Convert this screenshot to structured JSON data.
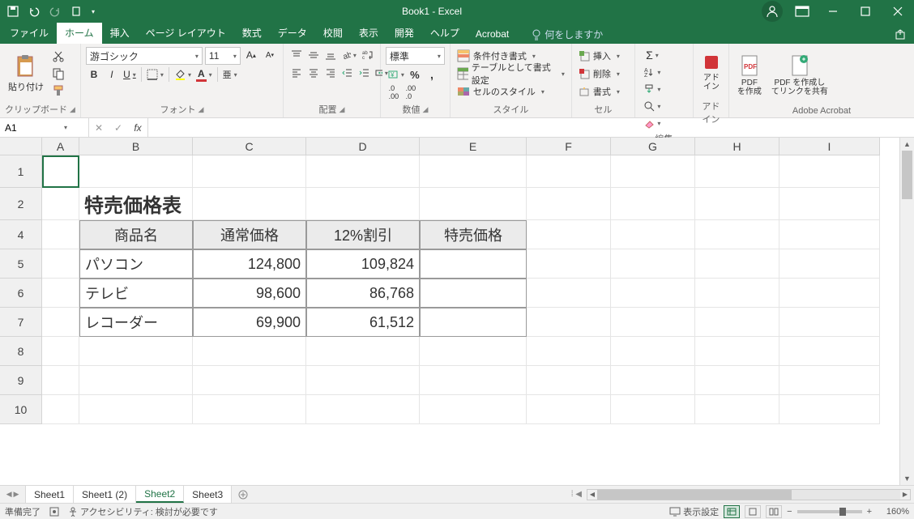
{
  "title": "Book1  -  Excel",
  "qat": {
    "save": "保存",
    "undo": "元に戻す",
    "redo": "やり直し",
    "new": "新規"
  },
  "tabs": {
    "file": "ファイル",
    "home": "ホーム",
    "insert": "挿入",
    "pagelayout": "ページ レイアウト",
    "formulas": "数式",
    "data": "データ",
    "review": "校閲",
    "view": "表示",
    "developer": "開発",
    "help": "ヘルプ",
    "acrobat": "Acrobat"
  },
  "tellme": "何をしますか",
  "share": "共有",
  "groups": {
    "clipboard": {
      "label": "クリップボード",
      "paste": "貼り付け"
    },
    "font": {
      "label": "フォント",
      "name": "游ゴシック",
      "size": "11",
      "bold": "B",
      "italic": "I",
      "underline": "U"
    },
    "alignment": {
      "label": "配置"
    },
    "number": {
      "label": "数値",
      "format": "標準"
    },
    "styles": {
      "label": "スタイル",
      "cond": "条件付き書式",
      "table": "テーブルとして書式設定",
      "cell": "セルのスタイル"
    },
    "cells": {
      "label": "セル",
      "insert": "挿入",
      "delete": "削除",
      "format": "書式"
    },
    "editing": {
      "label": "編集"
    },
    "addin": {
      "label": "アドイン",
      "btn": "アド\nイン"
    },
    "acrobat": {
      "label": "Adobe Acrobat",
      "create": "PDF\nを作成",
      "share": "PDF を作成し\nてリンクを共有"
    }
  },
  "namebox": "A1",
  "columns": [
    "A",
    "B",
    "C",
    "D",
    "E",
    "F",
    "G",
    "H",
    "I"
  ],
  "colwidths": {
    "A": 46,
    "B": 140,
    "C": 140,
    "D": 140,
    "E": 132,
    "F": 104,
    "G": 104,
    "H": 104,
    "I": 124
  },
  "rows": [
    1,
    2,
    4,
    5,
    6,
    7,
    8,
    9,
    10
  ],
  "rowheights": {
    "1": 40,
    "2": 40,
    "4": 36,
    "5": 36,
    "6": 36,
    "7": 36,
    "8": 36,
    "9": 36,
    "10": 36
  },
  "sheetTitle": "特売価格表",
  "table": {
    "headers": [
      "商品名",
      "通常価格",
      "12%割引",
      "特売価格"
    ],
    "rows": [
      {
        "name": "パソコン",
        "price": "124,800",
        "disc": "109,824"
      },
      {
        "name": "テレビ",
        "price": "98,600",
        "disc": "86,768"
      },
      {
        "name": "レコーダー",
        "price": "69,900",
        "disc": "61,512"
      }
    ]
  },
  "sheetTabs": [
    "Sheet1",
    "Sheet1 (2)",
    "Sheet2",
    "Sheet3"
  ],
  "activeSheet": "Sheet2",
  "status": {
    "ready": "準備完了",
    "access": "アクセシビリティ: 検討が必要です",
    "disp": "表示設定",
    "zoom": "160%"
  }
}
